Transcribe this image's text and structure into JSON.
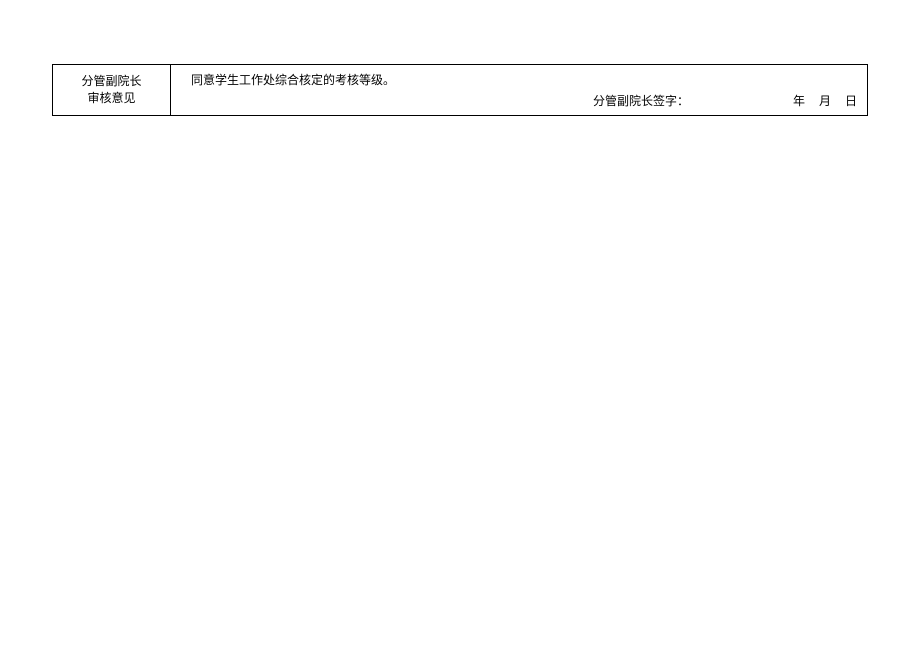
{
  "row": {
    "label_line1": "分管副院长",
    "label_line2": "审核意见",
    "opinion": "同意学生工作处综合核定的考核等级。",
    "signature_prompt": "分管副院长签字：",
    "date_year": "年",
    "date_month": "月",
    "date_day": "日"
  }
}
